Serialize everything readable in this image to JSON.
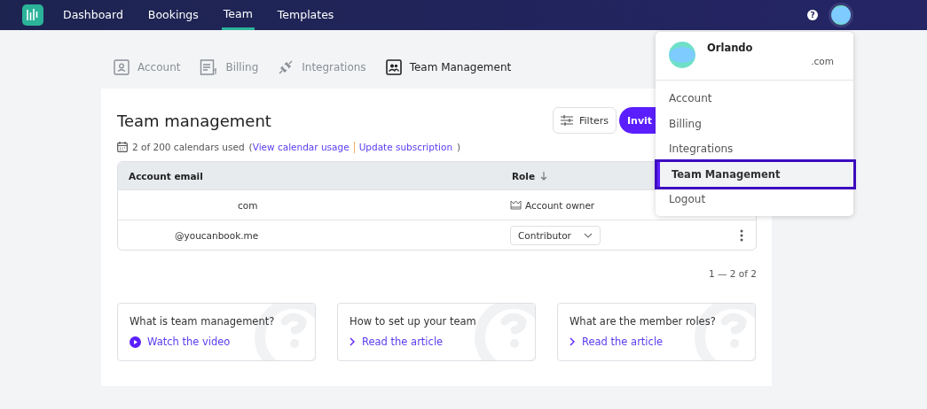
{
  "nav": {
    "items": [
      {
        "label": "Dashboard",
        "selected": false
      },
      {
        "label": "Bookings",
        "selected": false
      },
      {
        "label": "Team",
        "selected": true
      },
      {
        "label": "Templates",
        "selected": false
      }
    ],
    "help": "?"
  },
  "tabs": [
    {
      "label": "Account",
      "kind": "account",
      "selected": false
    },
    {
      "label": "Billing",
      "kind": "billing",
      "selected": false
    },
    {
      "label": "Integrations",
      "kind": "integrations",
      "selected": false
    },
    {
      "label": "Team Management",
      "kind": "team",
      "selected": true
    }
  ],
  "page": {
    "title": "Team management",
    "filters": "Filters",
    "invite": "Invit",
    "usage": "2 of 200 calendars used",
    "open_paren": "(",
    "usage_link": "View calendar usage",
    "subscription_link": "Update subscription",
    "close_paren": ")"
  },
  "table": {
    "columns": [
      "Account email",
      "Role"
    ],
    "rows": [
      {
        "email": "com",
        "role": "Account owner",
        "kind": "owner"
      },
      {
        "email": "@youcanbook.me",
        "role": "Contributor",
        "kind": "select"
      }
    ]
  },
  "pagination": "1 — 2 of 2",
  "cards": [
    {
      "title": "What is team management?",
      "link": "Watch the video",
      "kind": "video"
    },
    {
      "title": "How to set up your team",
      "link": "Read the article",
      "kind": "article"
    },
    {
      "title": "What are the member roles?",
      "link": "Read the article",
      "kind": "article"
    }
  ],
  "menu": {
    "name": "Orlando",
    "email": ".com",
    "items": [
      {
        "label": "Account",
        "selected": false
      },
      {
        "label": "Billing",
        "selected": false
      },
      {
        "label": "Integrations",
        "selected": false
      },
      {
        "label": "Team Management",
        "selected": true
      },
      {
        "label": "Logout",
        "selected": false
      }
    ]
  }
}
